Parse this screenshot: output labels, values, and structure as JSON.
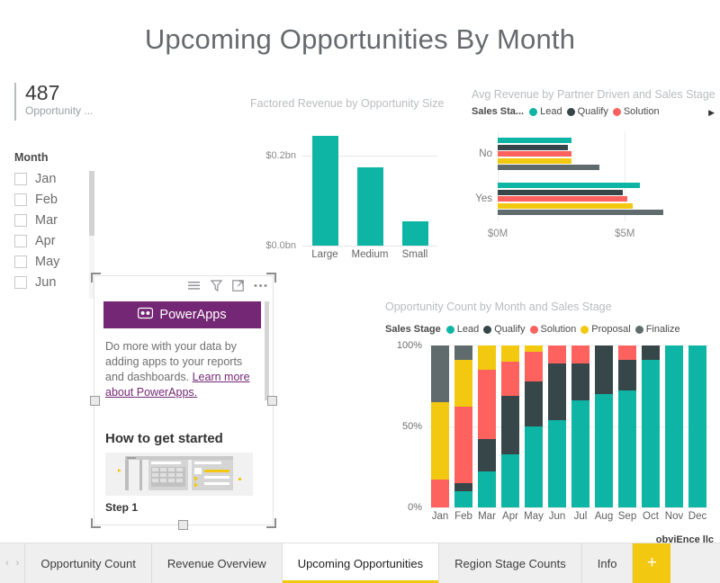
{
  "report": {
    "title": "Upcoming Opportunities By Month"
  },
  "kpi": {
    "value": "487",
    "label": "Opportunity ..."
  },
  "slicer": {
    "title": "Month",
    "items": [
      {
        "label": "Jan",
        "checked": false
      },
      {
        "label": "Feb",
        "checked": false
      },
      {
        "label": "Mar",
        "checked": false
      },
      {
        "label": "Apr",
        "checked": false
      },
      {
        "label": "May",
        "checked": false
      },
      {
        "label": "Jun",
        "checked": false
      }
    ]
  },
  "powerapps": {
    "brand": "PowerApps",
    "body_text": "Do more with your data by adding apps to your reports and dashboards. ",
    "link_text": "Learn more about PowerApps.",
    "heading": "How to get started",
    "step_label": "Step 1",
    "toolbar": [
      {
        "name": "menu-icon",
        "glyph": "☰"
      },
      {
        "name": "filter-icon",
        "glyph": "▽"
      },
      {
        "name": "focus-mode-icon",
        "glyph": "↗"
      },
      {
        "name": "more-options-icon",
        "glyph": "…"
      }
    ]
  },
  "watermark": "obviEnce llc",
  "tabs": {
    "items": [
      {
        "label": "Opportunity Count",
        "active": false
      },
      {
        "label": "Revenue Overview",
        "active": false
      },
      {
        "label": "Upcoming Opportunities",
        "active": true
      },
      {
        "label": "Region Stage Counts",
        "active": false
      },
      {
        "label": "Info",
        "active": false
      }
    ],
    "add_label": "+",
    "prev_label": "‹",
    "next_label": "›"
  },
  "colors": {
    "lead": "#0fb5a4",
    "qualify": "#374649",
    "solution": "#fd625e",
    "proposal": "#f2c811",
    "finalize": "#5f6b6d",
    "accent_yellow": "#f2c811",
    "powerapps_purple": "#742774"
  },
  "chart_data": [
    {
      "type": "bar",
      "id": "factored-revenue",
      "title": "Factored Revenue by Opportunity Size",
      "orientation": "vertical",
      "categories": [
        "Large",
        "Medium",
        "Small"
      ],
      "values": [
        0.245,
        0.175,
        0.055
      ],
      "ytick_labels": [
        "$0.0bn",
        "$0.2bn"
      ],
      "ytick_values": [
        0.0,
        0.2
      ],
      "ylim": [
        0,
        0.27
      ],
      "series_color": "#0fb5a4",
      "xlabel": "",
      "ylabel": "",
      "grid": true
    },
    {
      "type": "bar",
      "id": "avg-revenue-partner-driven",
      "title": "Avg Revenue by Partner Driven and Sales Stage",
      "orientation": "horizontal",
      "legend_title": "Sales Sta...",
      "legend_visible": [
        "Lead",
        "Qualify",
        "Solution"
      ],
      "legend_overflow_glyph": "▶",
      "legend_position": "top",
      "categories": [
        "No",
        "Yes"
      ],
      "series": [
        {
          "name": "Lead",
          "color": "#0fb5a4",
          "values": [
            2.9,
            5.6
          ]
        },
        {
          "name": "Qualify",
          "color": "#374649",
          "values": [
            2.75,
            4.9
          ]
        },
        {
          "name": "Solution",
          "color": "#fd625e",
          "values": [
            2.9,
            5.1
          ]
        },
        {
          "name": "Proposal",
          "color": "#f2c811",
          "values": [
            2.9,
            5.3
          ]
        },
        {
          "name": "Finalize",
          "color": "#5f6b6d",
          "values": [
            4.0,
            6.5
          ]
        }
      ],
      "xtick_labels": [
        "$0M",
        "$5M"
      ],
      "xtick_values": [
        0,
        5
      ],
      "xlim": [
        0,
        7.5
      ],
      "xlabel": "",
      "ylabel": "",
      "grid": true
    },
    {
      "type": "bar",
      "id": "opportunity-count-by-month-stage",
      "subtype": "stacked-100",
      "title": "Opportunity Count by Month and Sales Stage",
      "legend_title": "Sales Stage",
      "legend_position": "top",
      "categories": [
        "Jan",
        "Feb",
        "Mar",
        "Apr",
        "May",
        "Jun",
        "Jul",
        "Aug",
        "Sep",
        "Oct",
        "Nov",
        "Dec"
      ],
      "series": [
        {
          "name": "Lead",
          "color": "#0fb5a4",
          "values": [
            0,
            10,
            22,
            33,
            50,
            54,
            66,
            70,
            72,
            91,
            100,
            100
          ]
        },
        {
          "name": "Qualify",
          "color": "#374649",
          "values": [
            0,
            5,
            20,
            36,
            28,
            35,
            23,
            30,
            19,
            9,
            0,
            0
          ]
        },
        {
          "name": "Solution",
          "color": "#fd625e",
          "values": [
            17,
            47,
            43,
            21,
            18,
            11,
            11,
            0,
            9,
            0,
            0,
            0
          ]
        },
        {
          "name": "Proposal",
          "color": "#f2c811",
          "values": [
            48,
            29,
            15,
            10,
            4,
            0,
            0,
            0,
            0,
            0,
            0,
            0
          ]
        },
        {
          "name": "Finalize",
          "color": "#5f6b6d",
          "values": [
            35,
            9,
            0,
            0,
            0,
            0,
            0,
            0,
            0,
            0,
            0,
            0
          ]
        }
      ],
      "ytick_labels": [
        "0%",
        "50%",
        "100%"
      ],
      "ytick_values": [
        0,
        50,
        100
      ],
      "ylim": [
        0,
        100
      ],
      "xlabel": "",
      "ylabel": "",
      "grid": true
    }
  ]
}
